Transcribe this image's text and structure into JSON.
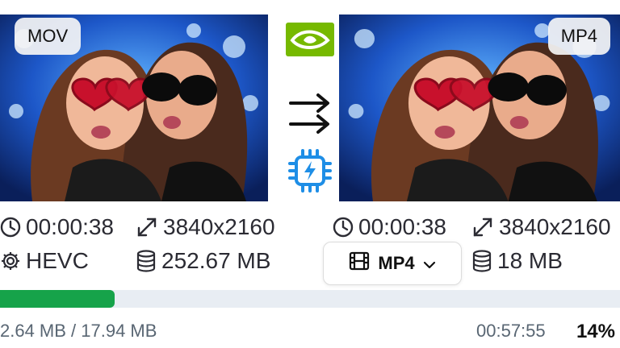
{
  "source": {
    "format_badge": "MOV",
    "duration": "00:00:38",
    "resolution": "3840x2160",
    "codec": "HEVC",
    "size": "252.67 MB"
  },
  "output": {
    "format_badge": "MP4",
    "duration": "00:00:38",
    "resolution": "3840x2160",
    "format_select_value": "MP4",
    "size": "18 MB"
  },
  "icons": {
    "duration": "clock-icon",
    "resolution": "resize-arrows-icon",
    "codec": "gear-icon",
    "size": "database-icon",
    "format": "film-icon",
    "gpu": "nvidia-logo-icon",
    "convert": "double-arrow-icon",
    "hw": "chip-lightning-icon"
  },
  "progress": {
    "fraction": 0.14,
    "transferred": "2.64 MB / 17.94 MB",
    "remaining_time": "00:57:55",
    "percent": "14%"
  },
  "colors": {
    "progress_fill": "#16a34a",
    "track": "#e8edf3",
    "nvidia_green": "#76b900",
    "chip_blue": "#1e8ee6"
  }
}
